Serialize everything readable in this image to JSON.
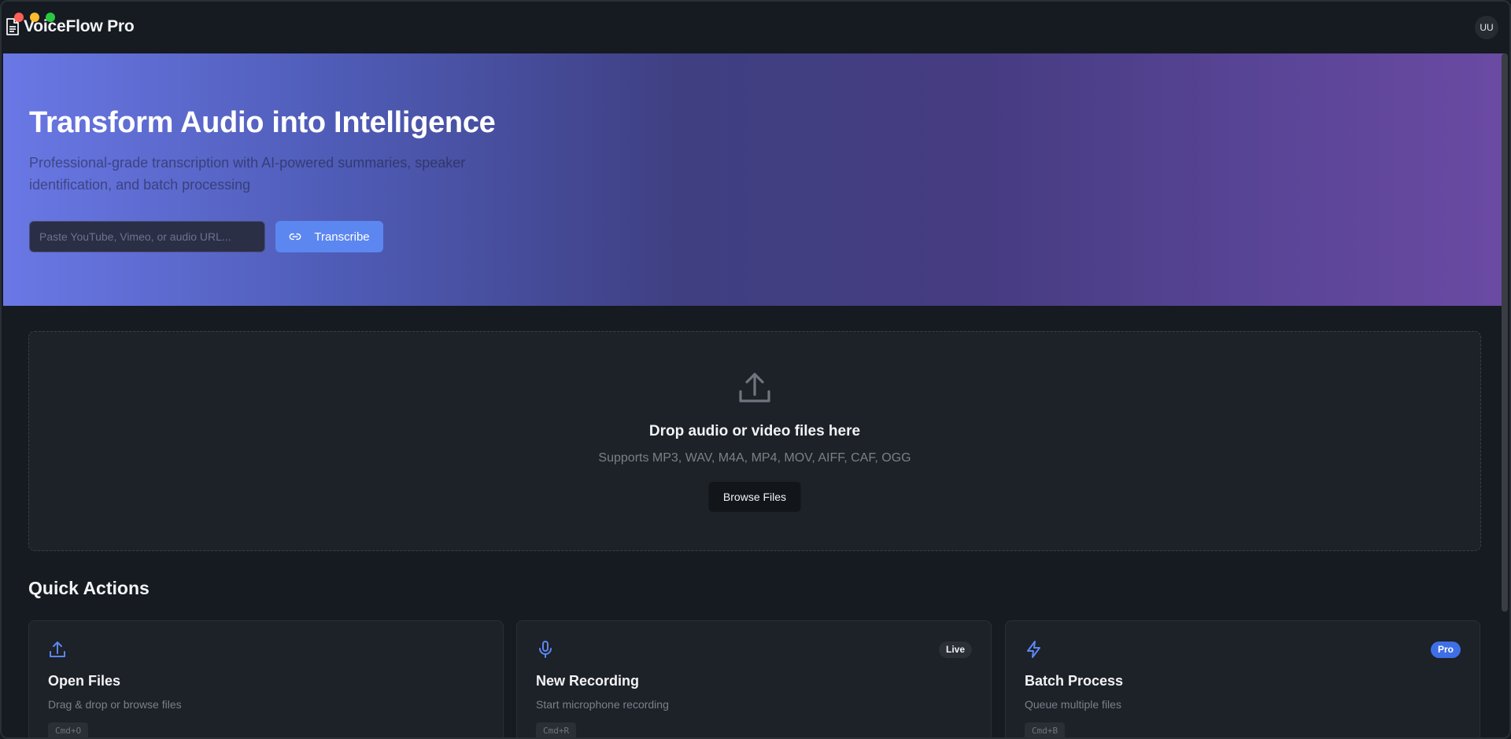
{
  "app": {
    "name": "VoiceFlow Pro",
    "user_initials": "UU"
  },
  "hero": {
    "title": "Transform Audio into Intelligence",
    "subtitle": "Professional-grade transcription with AI-powered summaries, speaker identification, and batch processing",
    "url_placeholder": "Paste YouTube, Vimeo, or audio URL...",
    "transcribe_label": "Transcribe"
  },
  "dropzone": {
    "title": "Drop audio or video files here",
    "formats": "Supports MP3, WAV, M4A, MP4, MOV, AIFF, CAF, OGG",
    "browse_label": "Browse Files"
  },
  "quick_actions": {
    "heading": "Quick Actions",
    "cards": [
      {
        "icon": "upload-icon",
        "title": "Open Files",
        "desc": "Drag & drop or browse files",
        "shortcut": "Cmd+O",
        "badge": ""
      },
      {
        "icon": "microphone-icon",
        "title": "New Recording",
        "desc": "Start microphone recording",
        "shortcut": "Cmd+R",
        "badge": "Live"
      },
      {
        "icon": "lightning-icon",
        "title": "Batch Process",
        "desc": "Queue multiple files",
        "shortcut": "Cmd+B",
        "badge": "Pro"
      }
    ]
  },
  "colors": {
    "accent": "#5c87f0",
    "background": "#161a21",
    "card": "#1d2128",
    "hero_start": "#6a78e6",
    "hero_end": "#6b4aa3"
  }
}
